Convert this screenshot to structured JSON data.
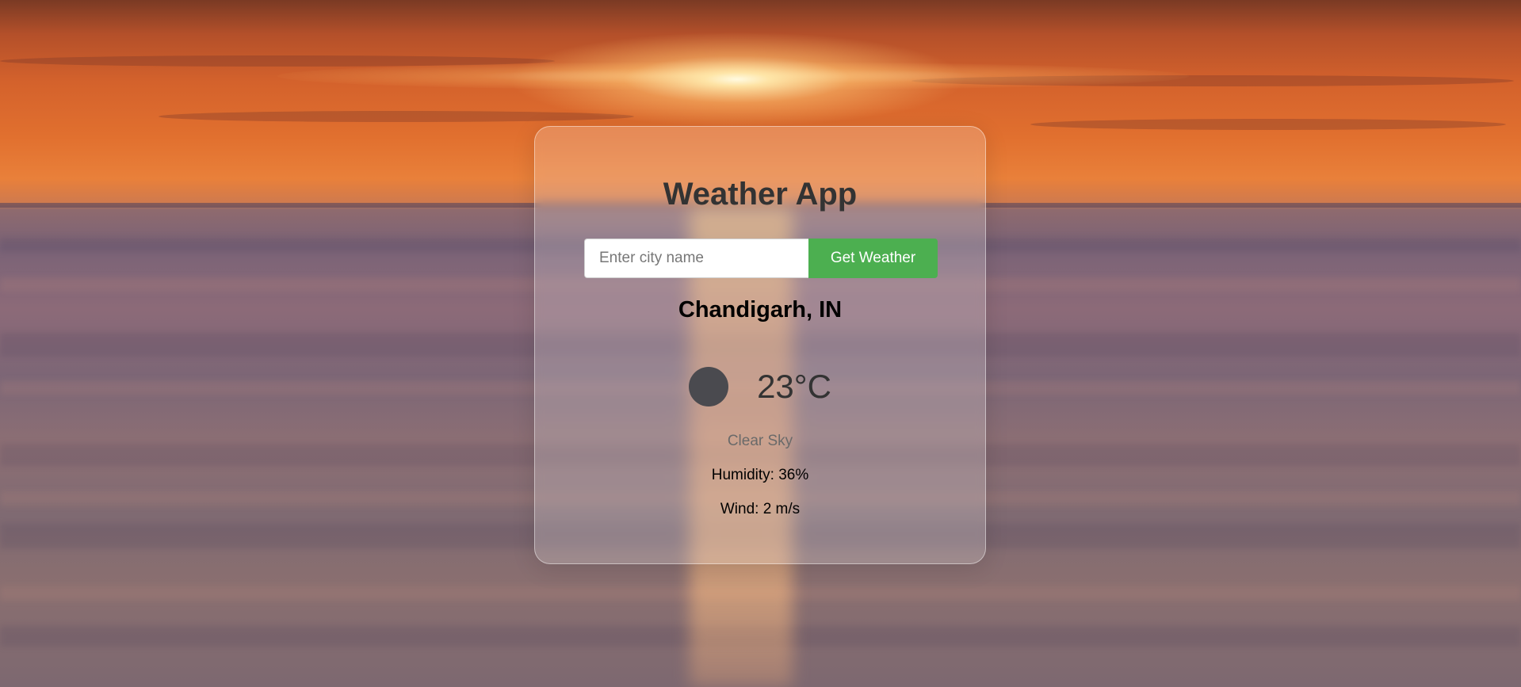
{
  "app": {
    "title": "Weather App"
  },
  "search": {
    "placeholder": "Enter city name",
    "value": "",
    "button_label": "Get Weather"
  },
  "weather": {
    "location": "Chandigarh, IN",
    "icon": "weather-condition-icon",
    "temperature": "23°C",
    "description": "Clear Sky",
    "humidity": "Humidity: 36%",
    "wind": "Wind: 2 m/s"
  },
  "colors": {
    "accent": "#4caf50",
    "title": "#333333",
    "card_background": "rgba(255,255,255,0.2)"
  }
}
